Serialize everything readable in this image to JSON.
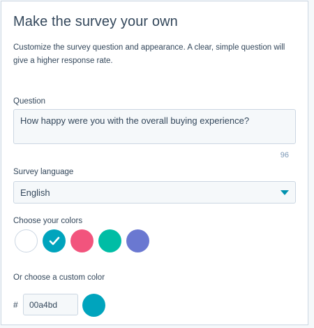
{
  "header": {
    "title": "Make the survey your own",
    "description": "Customize the survey question and appearance. A clear, simple question will give a higher response rate."
  },
  "question": {
    "label": "Question",
    "value": "How happy were you with the overall buying experience?",
    "char_count": "96"
  },
  "language": {
    "label": "Survey language",
    "selected": "English"
  },
  "colors": {
    "label": "Choose your colors",
    "swatches": [
      {
        "color": "#ffffff",
        "selected": false
      },
      {
        "color": "#00a4bd",
        "selected": true
      },
      {
        "color": "#f2547d",
        "selected": false
      },
      {
        "color": "#00bda5",
        "selected": false
      },
      {
        "color": "#6a78d1",
        "selected": false
      }
    ]
  },
  "custom_color": {
    "label": "Or choose a custom color",
    "prefix": "#",
    "value": "00a4bd",
    "preview_color": "#00a4bd"
  }
}
